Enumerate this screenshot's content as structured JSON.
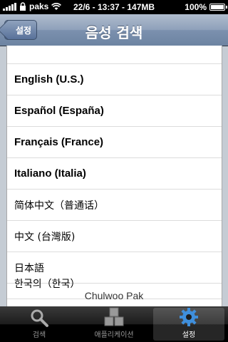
{
  "status_bar": {
    "carrier": "paks",
    "datetime": "22/6 - 13:37 - 147MB",
    "battery": "100%",
    "battery_level": 1.0
  },
  "nav": {
    "back_label": "설정",
    "title": "음성 검색"
  },
  "languages": [
    {
      "label": "English (U.S.)"
    },
    {
      "label": "Español (España)"
    },
    {
      "label": "Français (France)"
    },
    {
      "label": "Italiano (Italia)"
    },
    {
      "label": "简体中文（普通话）"
    },
    {
      "label": "中文 (台灣版)"
    },
    {
      "label": "日本語"
    },
    {
      "label": "한국의（한국）"
    }
  ],
  "watermark": "Chulwoo Pak",
  "tabbar": {
    "tabs": [
      {
        "label": "검색",
        "icon": "search-icon"
      },
      {
        "label": "애플리케이션",
        "icon": "apps-icon"
      },
      {
        "label": "설정",
        "icon": "gear-icon"
      }
    ],
    "active": "설정"
  },
  "colors": {
    "nav": "#6d84a2",
    "active_tab_icon": "#3f8fdc"
  }
}
